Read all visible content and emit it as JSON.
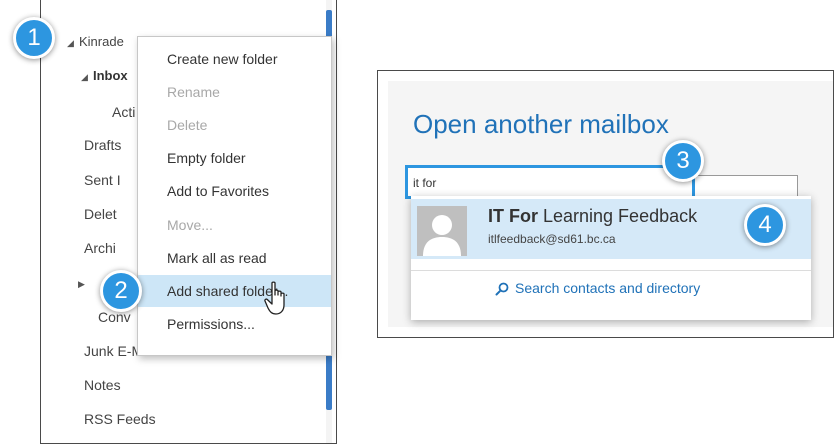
{
  "folder_tree": {
    "items": [
      {
        "label": "Kinrade"
      },
      {
        "label": "Inbox"
      },
      {
        "label": "Acti"
      },
      {
        "label": "Drafts"
      },
      {
        "label": "Sent I"
      },
      {
        "label": "Delet"
      },
      {
        "label": "Archi"
      },
      {
        "label": "Conv"
      },
      {
        "label": "Junk E-Mail"
      },
      {
        "label": "Notes"
      },
      {
        "label": "RSS Feeds"
      }
    ]
  },
  "context_menu": {
    "items": [
      {
        "label": "Create new folder",
        "state": "enabled"
      },
      {
        "label": "Rename",
        "state": "disabled"
      },
      {
        "label": "Delete",
        "state": "disabled"
      },
      {
        "label": "Empty folder",
        "state": "enabled"
      },
      {
        "label": "Add to Favorites",
        "state": "enabled"
      },
      {
        "label": "Move...",
        "state": "disabled"
      },
      {
        "label": "Mark all as read",
        "state": "enabled"
      },
      {
        "label": "Add shared folder...",
        "state": "highlighted"
      },
      {
        "label": "Permissions...",
        "state": "enabled"
      }
    ]
  },
  "steps": [
    "1",
    "2",
    "3",
    "4"
  ],
  "dialog": {
    "title": "Open another mailbox",
    "search_value": "it for",
    "suggestion": {
      "name_bold": "IT For",
      "name_rest": " Learning Feedback",
      "email": "itlfeedback@sd61.bc.ca"
    },
    "search_directory_label": "Search contacts and directory"
  },
  "colors": {
    "accent": "#2d96e0",
    "title_blue": "#2072b8",
    "highlight": "#cde6f7",
    "selected_row": "#d5e9f8"
  },
  "icons": [
    "hand-pointer-icon",
    "person-avatar-icon",
    "search-icon",
    "expand-triangle-icon",
    "collapse-triangle-icon"
  ]
}
